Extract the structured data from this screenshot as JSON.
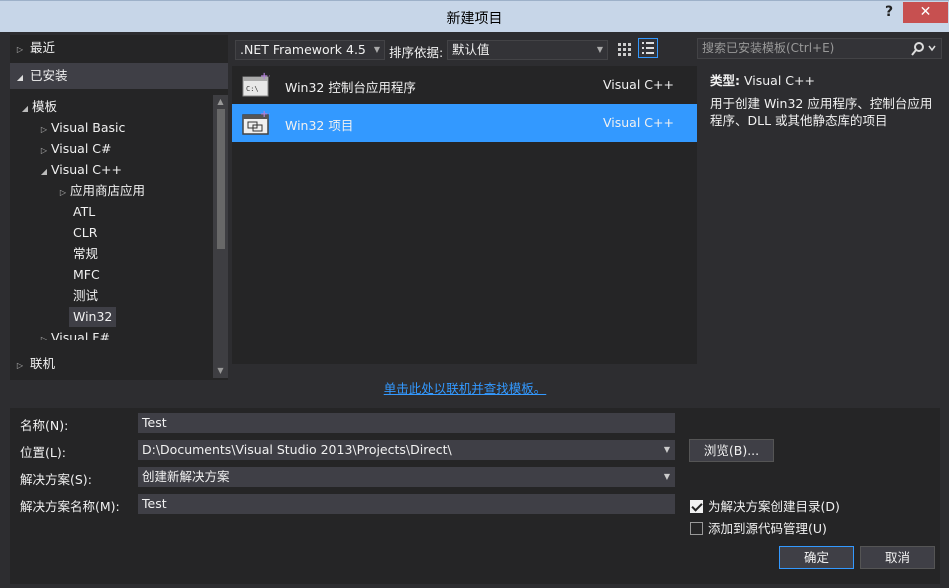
{
  "window": {
    "title": "新建项目",
    "help": "?",
    "close": "✕"
  },
  "sidebar": {
    "recent": "最近",
    "installed": "已安装",
    "templates": "模板",
    "tree": [
      {
        "label": "Visual Basic",
        "arrow": "▷"
      },
      {
        "label": "Visual C#",
        "arrow": "▷"
      },
      {
        "label": "Visual C++",
        "arrow": "◢"
      },
      {
        "label": "应用商店应用",
        "arrow": "▷"
      },
      {
        "label": "ATL"
      },
      {
        "label": "CLR"
      },
      {
        "label": "常规"
      },
      {
        "label": "MFC"
      },
      {
        "label": "测试"
      },
      {
        "label": "Win32"
      },
      {
        "label": "Visual F#",
        "arrow": "▷"
      }
    ],
    "online": "联机"
  },
  "toolbar": {
    "framework": ".NET Framework 4.5",
    "sort_label": "排序依据:",
    "sort_value": "默认值",
    "search_placeholder": "搜索已安装模板(Ctrl+E)"
  },
  "templates": [
    {
      "name": "Win32 控制台应用程序",
      "lang": "Visual C++",
      "selected": false
    },
    {
      "name": "Win32 项目",
      "lang": "Visual C++",
      "selected": true
    }
  ],
  "description": {
    "type_label": "类型:",
    "type_value": "Visual C++",
    "text": "用于创建 Win32 应用程序、控制台应用程序、DLL 或其他静态库的项目"
  },
  "online_link": "单击此处以联机并查找模板。",
  "form": {
    "name_label": "名称(N):",
    "name_value": "Test",
    "location_label": "位置(L):",
    "location_value": "D:\\Documents\\Visual Studio 2013\\Projects\\Direct\\",
    "solution_label": "解决方案(S):",
    "solution_value": "创建新解决方案",
    "solution_name_label": "解决方案名称(M):",
    "solution_name_value": "Test",
    "browse": "浏览(B)...",
    "create_dir": "为解决方案创建目录(D)",
    "create_dir_checked": true,
    "add_source": "添加到源代码管理(U)",
    "add_source_checked": false,
    "ok": "确定",
    "cancel": "取消"
  }
}
